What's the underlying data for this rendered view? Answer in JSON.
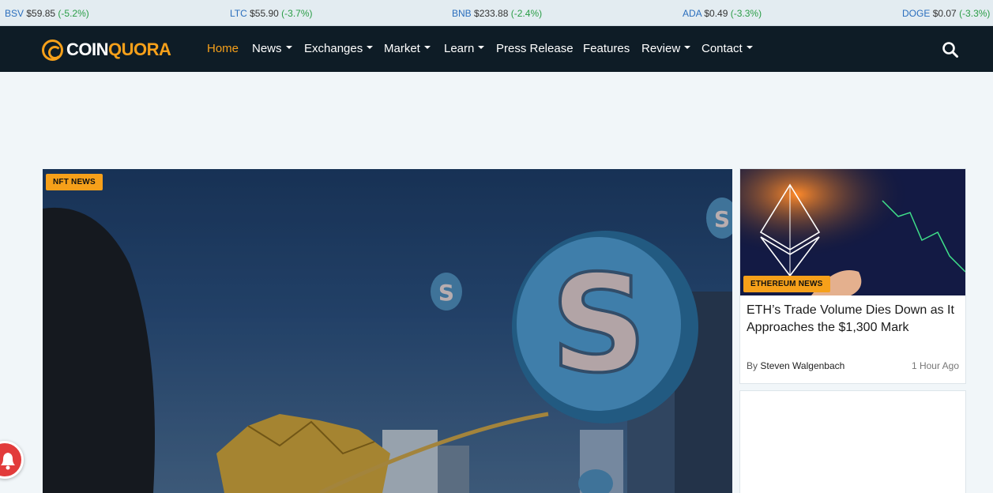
{
  "ticker": [
    {
      "symbol": "BSV",
      "price": "$59.85",
      "change": "(-5.2%)"
    },
    {
      "symbol": "LTC",
      "price": "$55.90",
      "change": "(-3.7%)"
    },
    {
      "symbol": "BNB",
      "price": "$233.88",
      "change": "(-2.4%)"
    },
    {
      "symbol": "ADA",
      "price": "$0.49",
      "change": "(-3.3%)"
    },
    {
      "symbol": "DOGE",
      "price": "$0.07",
      "change": "(-3.3%)"
    }
  ],
  "logo": {
    "part1": "COIN",
    "part2": "QUORA"
  },
  "nav": {
    "home": "Home",
    "news": "News",
    "exchanges": "Exchanges",
    "market": "Market",
    "learn": "Learn",
    "press": "Press Release",
    "features": "Features",
    "review": "Review",
    "contact": "Contact"
  },
  "hero": {
    "category": "NFT NEWS"
  },
  "side_article": {
    "category": "ETHEREUM NEWS",
    "title": "ETH’s Trade Volume Dies Down as It Approaches the $1,300 Mark",
    "by": "By",
    "author": "Steven Walgenbach",
    "time": "1 Hour Ago"
  },
  "colors": {
    "accent": "#f6a01a",
    "nav_bg": "#0e1c26",
    "positive": "#2a9d46"
  }
}
